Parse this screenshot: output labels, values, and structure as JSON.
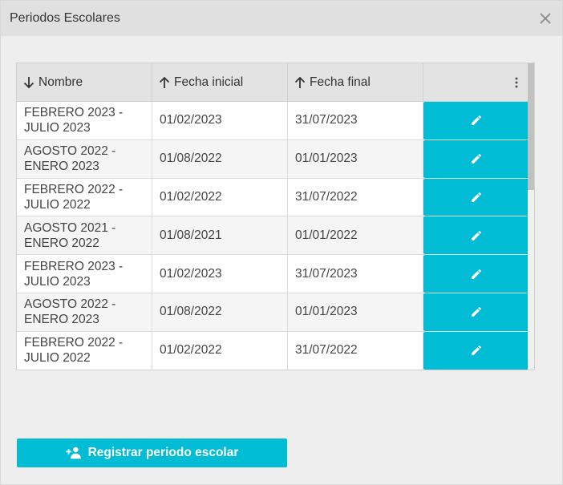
{
  "dialog": {
    "title": "Periodos Escolares",
    "close_icon": "close-icon"
  },
  "table": {
    "columns": [
      {
        "label": "Nombre",
        "sort": "descending",
        "icon": "arrow-down-icon"
      },
      {
        "label": "Fecha inicial",
        "sort": "ascending",
        "icon": "arrow-up-icon"
      },
      {
        "label": "Fecha final",
        "sort": "ascending",
        "icon": "arrow-up-icon"
      }
    ],
    "menu_icon": "more-vert-icon",
    "rows": [
      {
        "name_line1": "FEBRERO 2023 -",
        "name_line2": "JULIO 2023",
        "start": "01/02/2023",
        "end": "31/07/2023"
      },
      {
        "name_line1": "AGOSTO 2022 -",
        "name_line2": "ENERO 2023",
        "start": "01/08/2022",
        "end": "01/01/2023"
      },
      {
        "name_line1": "FEBRERO 2022 -",
        "name_line2": "JULIO 2022",
        "start": "01/02/2022",
        "end": "31/07/2022"
      },
      {
        "name_line1": "AGOSTO 2021 -",
        "name_line2": "ENERO 2022",
        "start": "01/08/2021",
        "end": "01/01/2022"
      },
      {
        "name_line1": "FEBRERO 2023 -",
        "name_line2": "JULIO 2023",
        "start": "01/02/2023",
        "end": "31/07/2023"
      },
      {
        "name_line1": "AGOSTO 2022 -",
        "name_line2": "ENERO 2023",
        "start": "01/08/2022",
        "end": "01/01/2023"
      },
      {
        "name_line1": "FEBRERO 2022 -",
        "name_line2": "JULIO 2022",
        "start": "01/02/2022",
        "end": "31/07/2022"
      }
    ],
    "edit_icon": "edit-pencil-icon"
  },
  "actions": {
    "register_label": "Registrar periodo escolar",
    "register_icon": "person-add-icon"
  },
  "colors": {
    "accent": "#00bcd4",
    "header_bg": "#e0e0e0",
    "body_bg": "#eeeeee"
  }
}
